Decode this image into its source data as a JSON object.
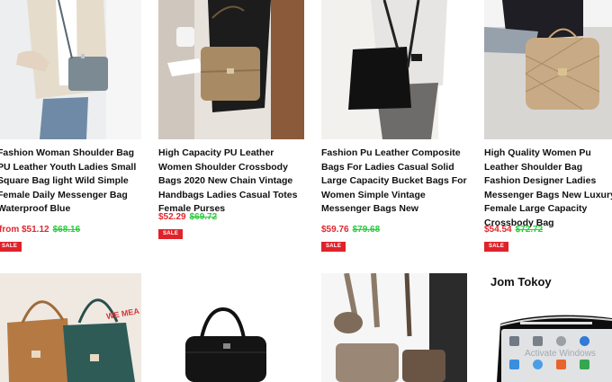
{
  "products": [
    {
      "title": "Fashion Woman Shoulder Bag PU Leather Youth Ladies Small Square Bag light Wild Simple Female Daily Messenger Bag Waterproof Blue",
      "price": "from $51.12",
      "old_price": "$68.16",
      "badge": "SALE"
    },
    {
      "title": "High Capacity PU Leather Women Shoulder Crossbody Bags 2020 New Chain Vintage Handbags Ladies Casual Totes Female Purses",
      "price": "$52.29",
      "old_price": "$69.72",
      "badge": "SALE"
    },
    {
      "title": "Fashion Pu Leather Composite Bags For Ladies Casual Solid Large Capacity Bucket Bags For Women Simple Vintage Messenger Bags New",
      "price": "$59.76",
      "old_price": "$79.68",
      "badge": "SALE"
    },
    {
      "title": "High Quality Women Pu Leather Shoulder Bag Fashion Designer Ladies Messenger Bags New Luxury Female Large Capacity Crossbody Bag",
      "price": "$54.54",
      "old_price": "$72.72",
      "badge": "SALE"
    }
  ],
  "second_row": {
    "brand_text": "Jom Tokoy",
    "tote_print": "WE MEA",
    "watermark": "Activate Windows"
  },
  "colors": {
    "price": "#e0282e",
    "old_price": "#2ecc40",
    "sale_badge": "#e0222a"
  }
}
